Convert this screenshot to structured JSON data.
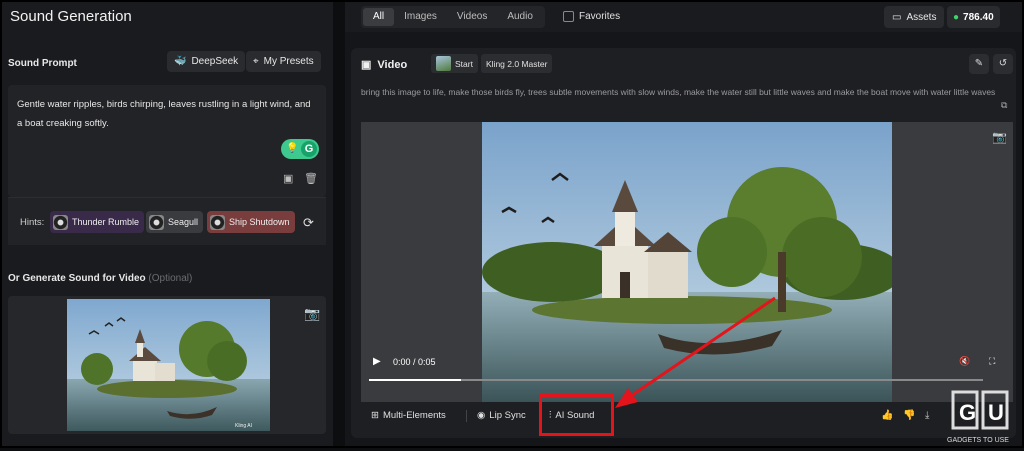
{
  "left": {
    "title": "Sound Generation",
    "prompt_label": "Sound Prompt",
    "deepseek_label": "DeepSeek",
    "presets_label": "My Presets",
    "prompt_text": "Gentle water ripples, birds chirping, leaves rustling in a light wind, and a boat creaking softly.",
    "hints_label": "Hints:",
    "hints": [
      {
        "label": "Thunder Rumble",
        "color": "#3a2a4a"
      },
      {
        "label": "Seagull",
        "color": "#3a3b3f"
      },
      {
        "label": "Ship Shutdown",
        "color": "#7a3d3d"
      }
    ],
    "optional_label": "Or Generate Sound for Video",
    "optional_hint": "(Optional)",
    "video_watermark": "Kling AI"
  },
  "topbar": {
    "tabs": [
      "All",
      "Images",
      "Videos",
      "Audio"
    ],
    "active_tab": "All",
    "favorites_label": "Favorites",
    "assets_label": "Assets",
    "credits": "786.40"
  },
  "card": {
    "title": "Video",
    "start_tag": "Start",
    "model_tag": "Kling 2.0 Master",
    "description": "bring this image to life, make those birds fly, trees subtle movements with slow winds, make the water still but little waves and make the boat move with water little waves",
    "time": "0:00 / 0:05",
    "progress": 0.15,
    "actions": [
      "Multi-Elements",
      "Lip Sync",
      "AI Sound"
    ],
    "highlight_color": "#e3141b"
  },
  "watermark": {
    "tagline": "GADGETS TO USE"
  }
}
